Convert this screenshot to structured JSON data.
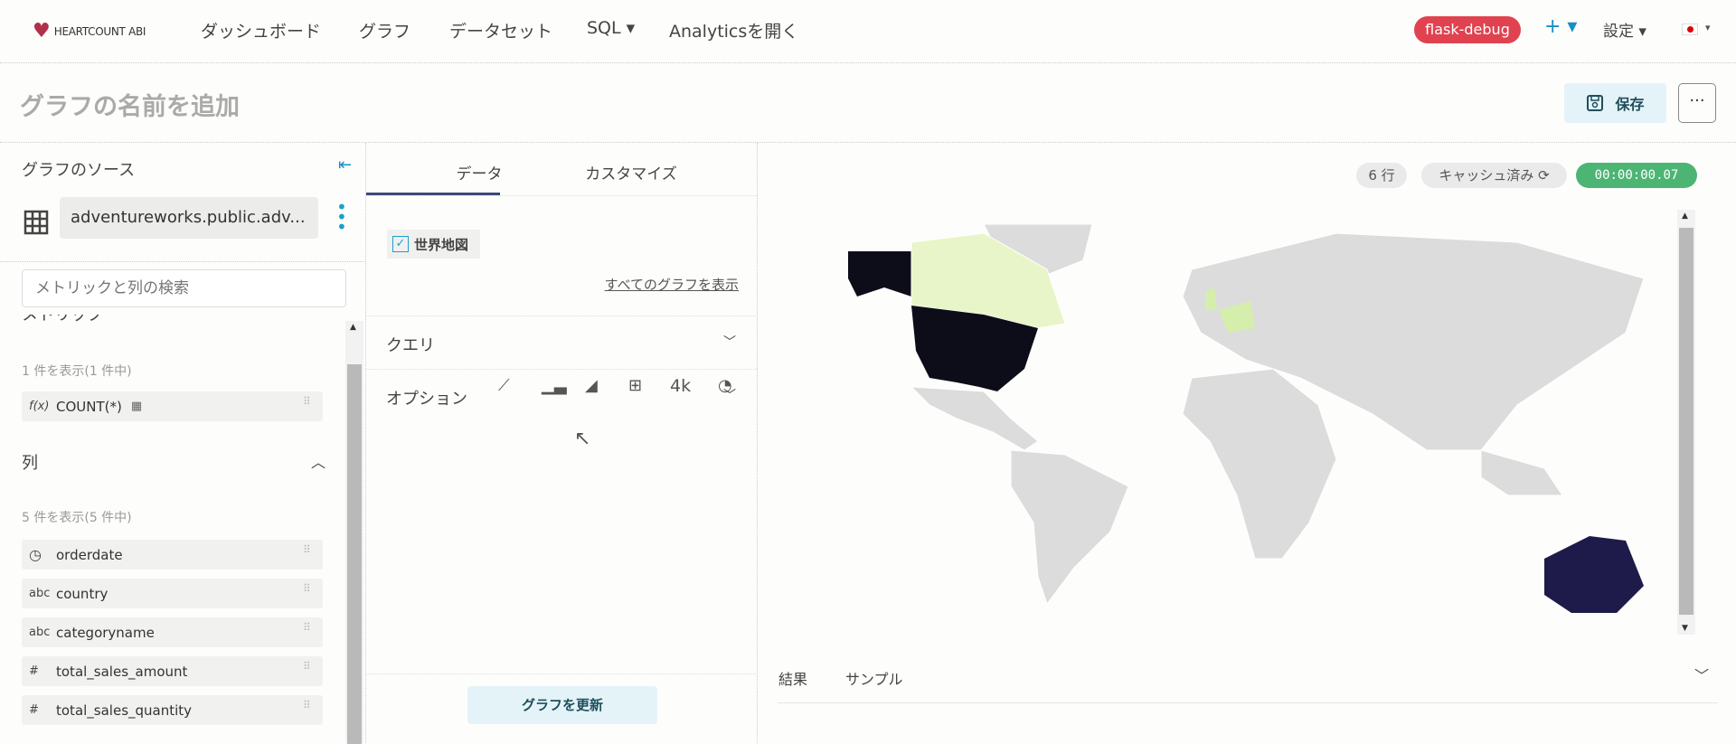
{
  "nav": {
    "brand": "HEARTCOUNT ABI",
    "items": [
      "ダッシュボード",
      "グラフ",
      "データセット",
      "SQL ▾",
      "Analyticsを開く"
    ],
    "env_badge": "flask-debug",
    "plus": "+ ▾",
    "settings": "設定 ▾",
    "lang": "▾",
    "env_color": "#e0424f"
  },
  "header": {
    "title_placeholder": "グラフの名前を追加",
    "save": "保存",
    "more": "···"
  },
  "left": {
    "title": "グラフのソース",
    "datasource": "adventureworks.public.adv...",
    "search_placeholder": "メトリックと列の検索",
    "metrics_header": "メトリック",
    "metrics_count": "1 件を表示(1 件中)",
    "metrics": [
      {
        "type": "f(x)",
        "name": "COUNT(*)"
      }
    ],
    "columns_header": "列",
    "columns_count": "5 件を表示(5 件中)",
    "columns": [
      {
        "type": "clock",
        "name": "orderdate"
      },
      {
        "type": "abc",
        "name": "country"
      },
      {
        "type": "abc",
        "name": "categoryname"
      },
      {
        "type": "#",
        "name": "total_sales_amount"
      },
      {
        "type": "#",
        "name": "total_sales_quantity"
      }
    ]
  },
  "mid": {
    "tabs": [
      "データ",
      "カスタマイズ"
    ],
    "active_tab": "データ",
    "selected_chart": "世界地図",
    "chart_types": [
      "line-chart",
      "bar-chart",
      "area-chart",
      "table",
      "4k",
      "pie-chart"
    ],
    "big_number": "4k",
    "all_charts": "すべてのグラフを表示",
    "sections": [
      "クエリ",
      "オプション"
    ],
    "update": "グラフを更新"
  },
  "right": {
    "rows": "6 行",
    "cached": "キャッシュ済み",
    "time": "00:00:00.07",
    "time_color": "#4cb574",
    "tabs": [
      "結果",
      "サンプル"
    ],
    "map_colors": {
      "high": "#0d0d1a",
      "mid": "#1e1a4a",
      "low": "#e8f5c8",
      "lowmid": "#d6eeab",
      "none": "#dcdcdc"
    }
  }
}
